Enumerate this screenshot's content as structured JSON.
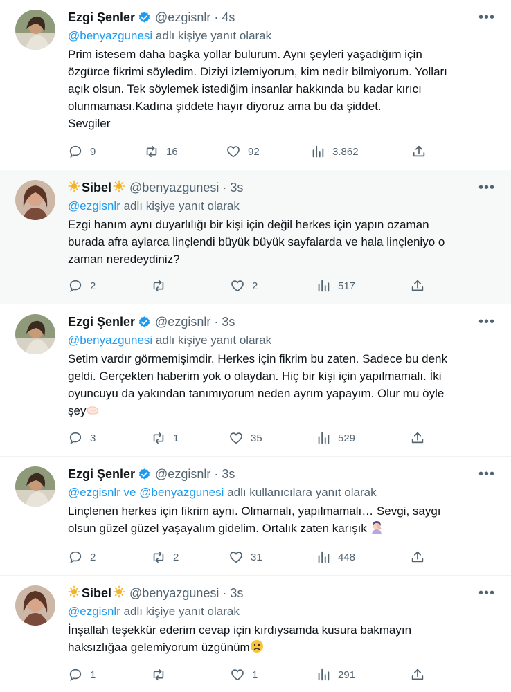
{
  "colors": {
    "accent": "#1d9bf0",
    "muted": "#536471",
    "text": "#0f1419",
    "highlight_bg": "#f7f9f9"
  },
  "tweets": [
    {
      "name": "Ezgi Şenler",
      "verified": true,
      "handle": "@ezgisnlr",
      "time": "4s",
      "reply_links": "@benyazgunesi",
      "reply_suffix": "adlı kişiye yanıt olarak",
      "lines": [
        "Prim istesem daha başka yollar bulurum. Aynı şeyleri yaşadığım için",
        "özgürce fikrimi söyledim. Diziyi izlemiyorum, kim nedir bilmiyorum. Yolları",
        "açık olsun. Tek söylemek istediğim insanlar hakkında bu kadar kırıcı",
        "olunmaması.Kadına şiddete hayır diyoruz ama bu da şiddet.",
        "Sevgiler"
      ],
      "stats": {
        "replies": "9",
        "retweets": "16",
        "likes": "92",
        "views": "3.862"
      }
    },
    {
      "name": "Sibel",
      "verified": false,
      "handle": "@benyazgunesi",
      "time": "3s",
      "reply_links": "@ezgisnlr",
      "reply_suffix": "adlı kişiye yanıt olarak",
      "lines": [
        "Ezgi hanım aynı duyarlılığı bir kişi için değil herkes için yapın ozaman",
        "burada afra  aylarca linçlendi büyük büyük sayfalarda ve hala linçleniyo  o",
        "zaman neredeydiniz?"
      ],
      "stats": {
        "replies": "2",
        "retweets": "",
        "likes": "2",
        "views": "517"
      }
    },
    {
      "name": "Ezgi Şenler",
      "verified": true,
      "handle": "@ezgisnlr",
      "time": "3s",
      "reply_links": "@benyazgunesi",
      "reply_suffix": "adlı kişiye yanıt olarak",
      "lines": [
        "Setim vardır görmemişimdir. Herkes için fikrim bu zaten. Sadece bu denk",
        "geldi. Gerçekten haberim yok o olaydan. Hiç bir kişi için yapılmamalı. İki",
        "oyuncuyu da yakından tanımıyorum neden ayrım yapayım. Olur mu öyle",
        "şey"
      ],
      "stats": {
        "replies": "3",
        "retweets": "1",
        "likes": "35",
        "views": "529"
      }
    },
    {
      "name": "Ezgi Şenler",
      "verified": true,
      "handle": "@ezgisnlr",
      "time": "3s",
      "reply_links": "@ezgisnlr ve @benyazgunesi",
      "reply_suffix": "adlı kullanıcılara yanıt olarak",
      "lines": [
        "Linçlenen herkes için fikrim aynı. Olmamalı, yapılmamalı… Sevgi, saygı",
        "olsun güzel güzel yaşayalım gidelim. Ortalık zaten karışık"
      ],
      "stats": {
        "replies": "2",
        "retweets": "2",
        "likes": "31",
        "views": "448"
      }
    },
    {
      "name": "Sibel",
      "verified": false,
      "handle": "@benyazgunesi",
      "time": "3s",
      "reply_links": "@ezgisnlr",
      "reply_suffix": "adlı kişiye yanıt olarak",
      "lines": [
        "İnşallah teşekkür ederim cevap için kırdıysamda kusura bakmayın",
        "haksızlığaa gelemiyorum üzgünüm"
      ],
      "stats": {
        "replies": "1",
        "retweets": "",
        "likes": "1",
        "views": "291"
      }
    }
  ]
}
